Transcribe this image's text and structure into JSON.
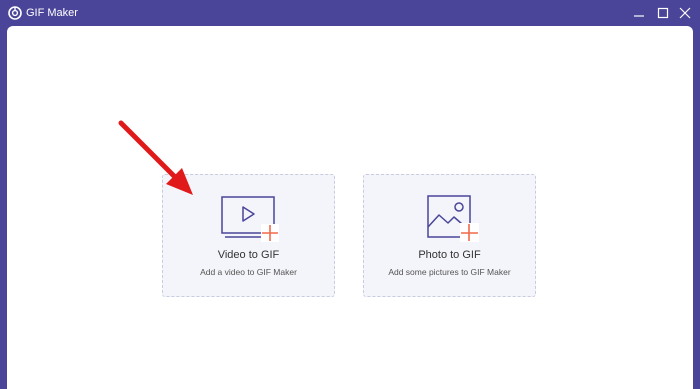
{
  "window": {
    "title": "GIF Maker",
    "icons": [
      "app-logo-icon",
      "minimize-icon",
      "maximize-icon",
      "close-icon"
    ]
  },
  "cards": [
    {
      "title": "Video to GIF",
      "subtitle": "Add a video to GIF Maker",
      "icon": "video-add-icon"
    },
    {
      "title": "Photo to GIF",
      "subtitle": "Add some pictures to GIF Maker",
      "icon": "photo-add-icon"
    }
  ],
  "colors": {
    "titlebar": "#4a4599",
    "icon_stroke": "#4a4599",
    "plus": "#f06a4a",
    "arrow": "#e01a1a",
    "card_bg": "#f4f5fa",
    "card_border": "#c9cce0"
  },
  "annotation": {
    "type": "red-arrow",
    "points_to": "video-to-gif-card"
  }
}
